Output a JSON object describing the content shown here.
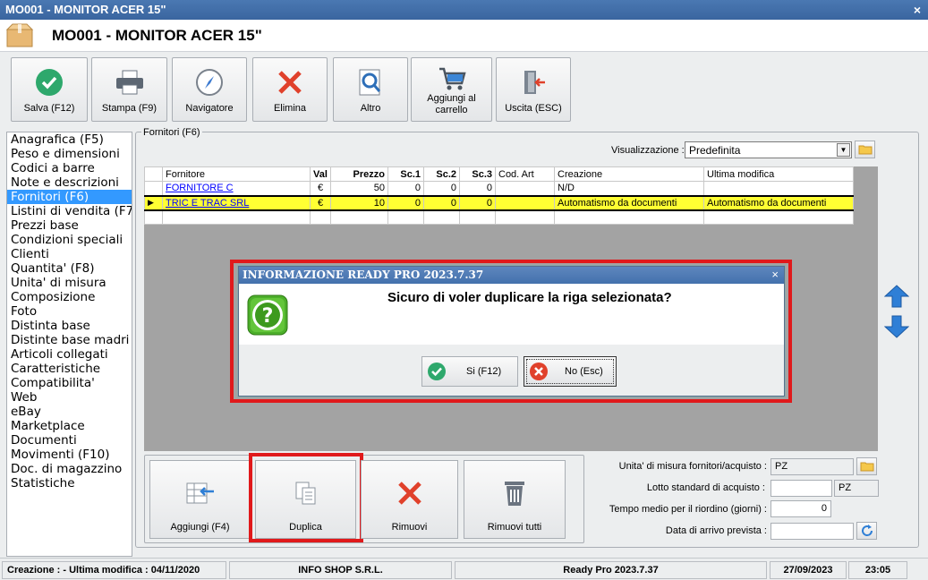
{
  "window": {
    "title": "MO001 - MONITOR ACER 15\"",
    "close": "×"
  },
  "header": {
    "title": "MO001 - MONITOR ACER 15\""
  },
  "toolbar": {
    "save": "Salva (F12)",
    "print": "Stampa (F9)",
    "navigator": "Navigatore",
    "delete": "Elimina",
    "other": "Altro",
    "cart_line1": "Aggiungi al",
    "cart_line2": "carrello",
    "exit": "Uscita (ESC)"
  },
  "sidebar": {
    "items": [
      "Anagrafica (F5)",
      "Peso e dimensioni",
      "Codici a barre",
      "Note e descrizioni",
      "Fornitori (F6)",
      "Listini di vendita (F7",
      "Prezzi base",
      "Condizioni speciali",
      "Clienti",
      "Quantita' (F8)",
      "Unita' di misura",
      "Composizione",
      "Foto",
      "Distinta base",
      "Distinte base madri",
      "Articoli collegati",
      "Caratteristiche",
      "Compatibilita'",
      "Web",
      "eBay",
      "Marketplace",
      "Documenti",
      "Movimenti (F10)",
      "Doc. di magazzino",
      "Statistiche"
    ],
    "selected_index": 4
  },
  "suppliers": {
    "group_title": "Fornitori (F6)",
    "view_label": "Visualizzazione :",
    "view_value": "Predefinita",
    "columns": [
      "Fornitore",
      "Val",
      "Prezzo",
      "Sc.1",
      "Sc.2",
      "Sc.3",
      "Cod. Art",
      "Creazione",
      "Ultima modifica"
    ],
    "rows": [
      [
        "FORNITORE C",
        "€",
        "50",
        "0",
        "0",
        "0",
        "",
        "N/D",
        ""
      ],
      [
        "TRIC E TRAC SRL",
        "€",
        "10",
        "0",
        "0",
        "0",
        "",
        "Automatismo da documenti",
        "Automatismo da documenti"
      ]
    ]
  },
  "bottom_buttons": {
    "add": "Aggiungi (F4)",
    "duplicate": "Duplica",
    "remove": "Rimuovi",
    "remove_all": "Rimuovi tutti"
  },
  "fields": {
    "uom_label": "Unita' di misura fornitori/acquisto :",
    "uom_value": "PZ",
    "lot_label": "Lotto standard di acquisto :",
    "lot_value": "",
    "lot_unit": "PZ",
    "lead_label": "Tempo medio per il riordino (giorni) :",
    "lead_value": "0",
    "arrival_label": "Data di arrivo prevista :",
    "arrival_value": ""
  },
  "dialog": {
    "title": "INFORMAZIONE READY PRO 2023.7.37",
    "close": "×",
    "message": "Sicuro di voler duplicare la riga selezionata?",
    "yes": "Si (F12)",
    "no": "No (Esc)"
  },
  "status": {
    "created": "Creazione : - Ultima modifica : 04/11/2020",
    "company": "INFO SHOP S.R.L.",
    "version": "Ready Pro 2023.7.37",
    "date": "27/09/2023",
    "time": "23:05"
  },
  "colors": {
    "accent": "#3399ff",
    "selected_row": "#ffff33",
    "highlight_frame": "#e0191b"
  }
}
